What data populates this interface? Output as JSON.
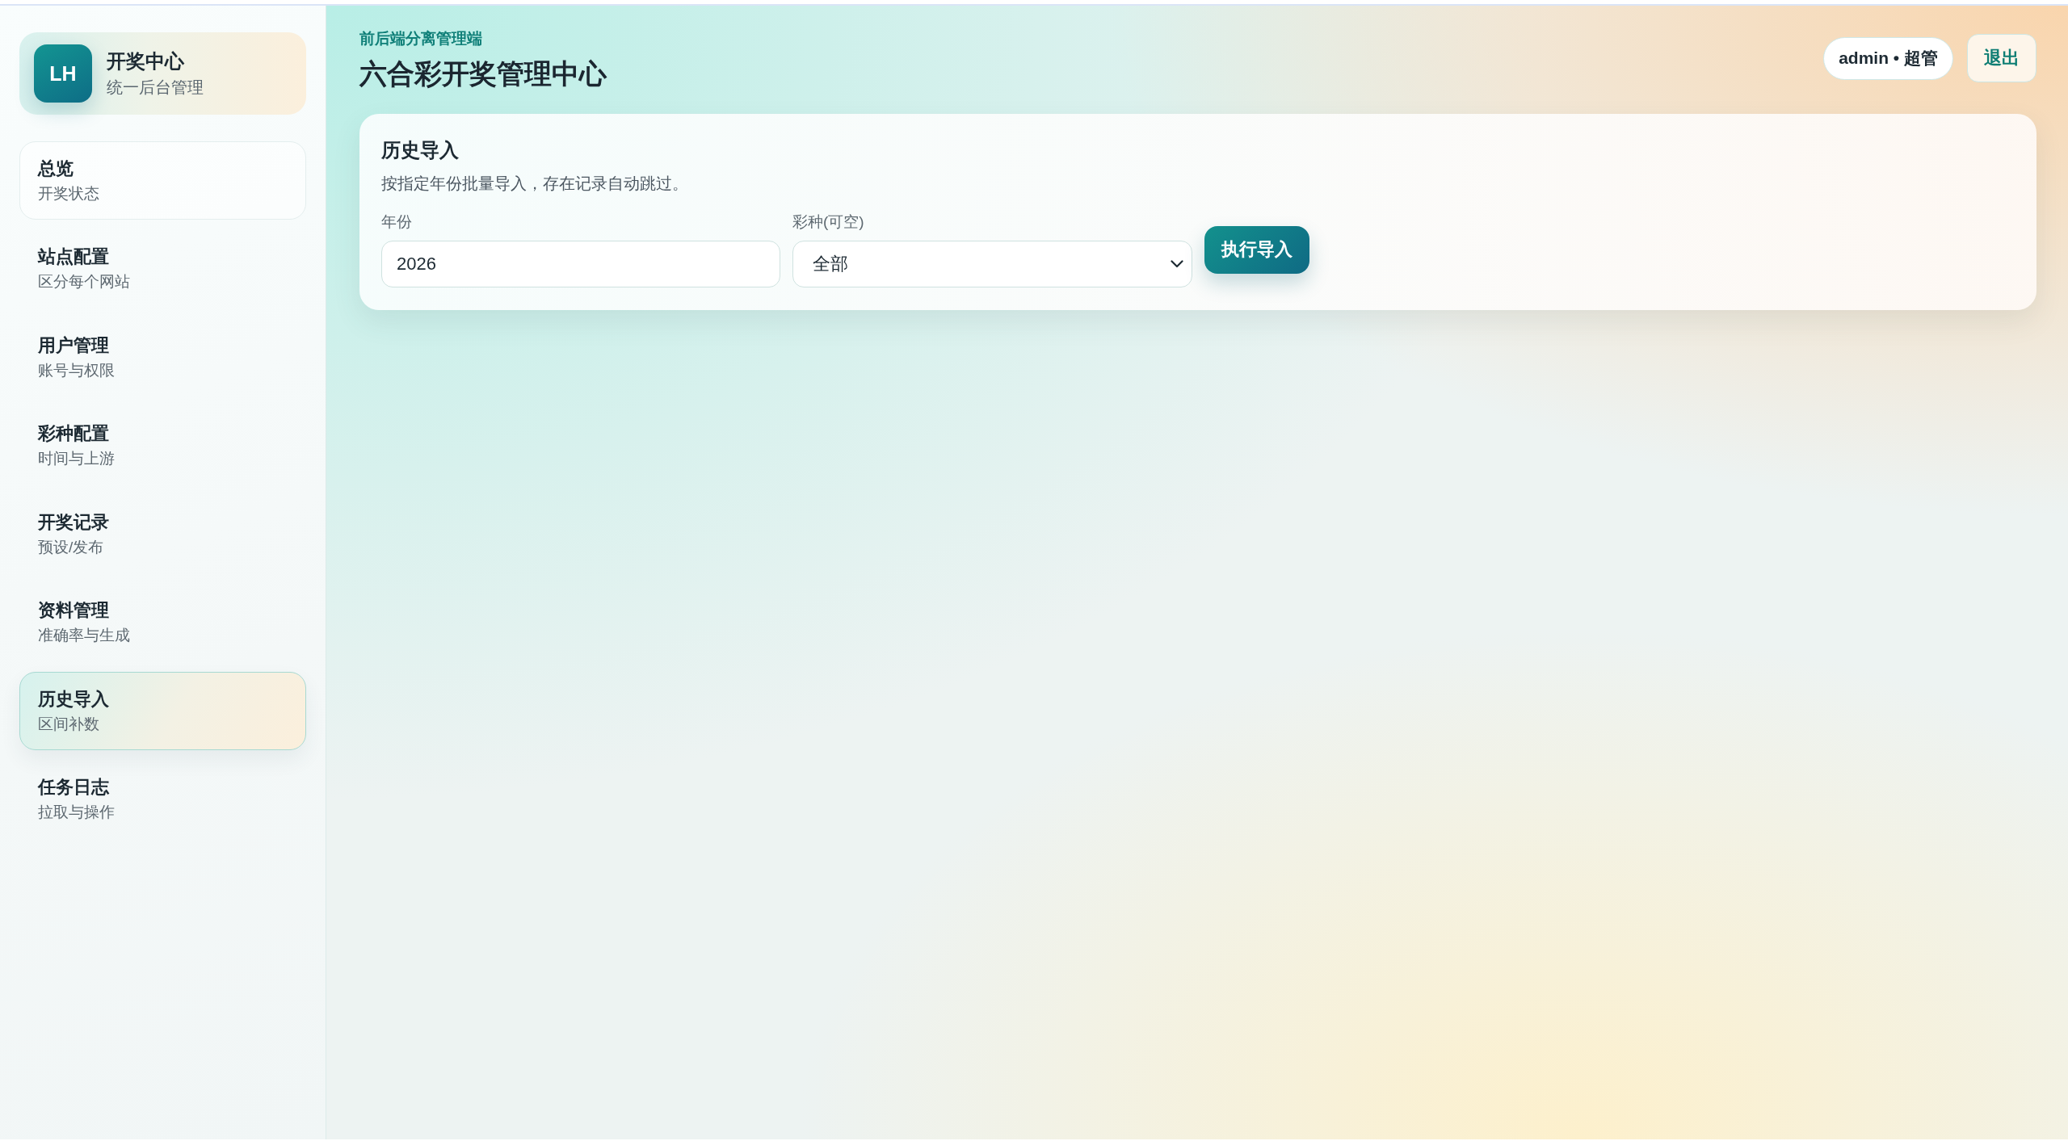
{
  "sidebar": {
    "brand": {
      "logo": "LH",
      "title": "开奖中心",
      "subtitle": "统一后台管理"
    },
    "items": [
      {
        "label": "总览",
        "description": "开奖状态",
        "selected": false,
        "hovered": true
      },
      {
        "label": "站点配置",
        "description": "区分每个网站",
        "selected": false,
        "hovered": false
      },
      {
        "label": "用户管理",
        "description": "账号与权限",
        "selected": false,
        "hovered": false
      },
      {
        "label": "彩种配置",
        "description": "时间与上游",
        "selected": false,
        "hovered": false
      },
      {
        "label": "开奖记录",
        "description": "预设/发布",
        "selected": false,
        "hovered": false
      },
      {
        "label": "资料管理",
        "description": "准确率与生成",
        "selected": false,
        "hovered": false
      },
      {
        "label": "历史导入",
        "description": "区间补数",
        "selected": true,
        "hovered": false
      },
      {
        "label": "任务日志",
        "description": "拉取与操作",
        "selected": false,
        "hovered": false
      }
    ]
  },
  "header": {
    "eyebrow": "前后端分离管理端",
    "title": "六合彩开奖管理中心",
    "user": "admin • 超管",
    "logout": "退出"
  },
  "card": {
    "title": "历史导入",
    "description": "按指定年份批量导入，存在记录自动跳过。",
    "fields": [
      {
        "kind": "input",
        "label": "年份",
        "value": "2026"
      },
      {
        "kind": "select",
        "label": "彩种(可空)",
        "value": "全部"
      }
    ],
    "submit": "执行导入"
  }
}
